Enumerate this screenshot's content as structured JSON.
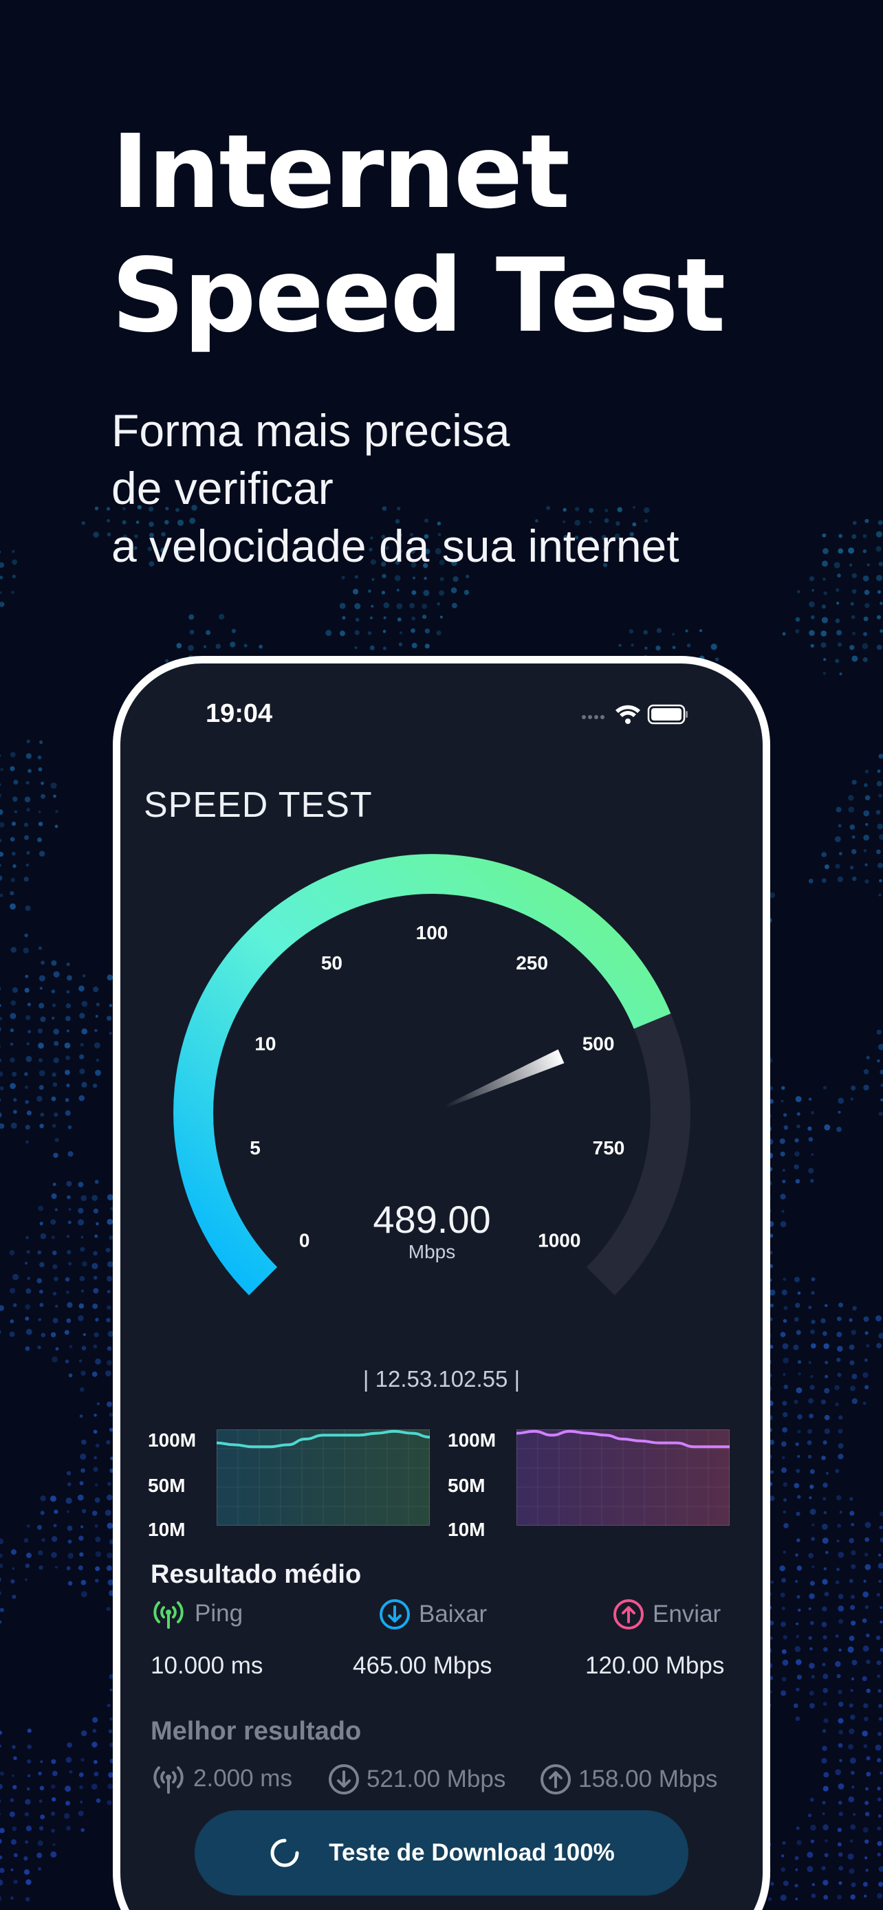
{
  "promo": {
    "title_line1": "Internet",
    "title_line2": "Speed Test",
    "subtitle_line1": "Forma mais precisa",
    "subtitle_line2": "de verificar",
    "subtitle_line3": "a velocidade da sua internet"
  },
  "status_bar": {
    "time": "19:04",
    "icons": [
      "signal-dots-icon",
      "wifi-icon",
      "battery-icon"
    ]
  },
  "app": {
    "title": "SPEED TEST"
  },
  "gauge": {
    "ticks": [
      "0",
      "5",
      "10",
      "50",
      "100",
      "250",
      "500",
      "750",
      "1000"
    ],
    "value": "489.00",
    "unit": "Mbps",
    "fill_fraction": 0.75,
    "colors": {
      "start": "#00b4ff",
      "mid": "#5ef2d8",
      "end": "#6ef58a",
      "track": "#262a38"
    }
  },
  "ip": "| 12.53.102.55 |",
  "download_chart": {
    "labels": [
      "100M",
      "50M",
      "10M"
    ],
    "line_color": "#4fd8d0",
    "values": [
      0.86,
      0.84,
      0.82,
      0.82,
      0.84,
      0.9,
      0.94,
      0.94,
      0.94,
      0.96,
      0.98,
      0.96,
      0.92
    ]
  },
  "upload_chart": {
    "labels": [
      "100M",
      "50M",
      "10M"
    ],
    "line_color": "#d080ff",
    "values": [
      0.96,
      0.98,
      0.94,
      0.98,
      0.96,
      0.94,
      0.9,
      0.88,
      0.86,
      0.86,
      0.82,
      0.82,
      0.82
    ]
  },
  "average": {
    "title": "Resultado médio",
    "ping_label": "Ping",
    "ping_value": "10.000 ms",
    "download_label": "Baixar",
    "download_value": "465.00 Mbps",
    "upload_label": "Enviar",
    "upload_value": "120.00 Mbps",
    "colors": {
      "ping": "#59d96b",
      "download": "#1aa8f0",
      "upload": "#f0568e"
    }
  },
  "best": {
    "title": "Melhor resultado",
    "ping_value": "2.000 ms",
    "download_value": "521.00 Mbps",
    "upload_value": "158.00 Mbps"
  },
  "cta": {
    "label": "Teste de Download 100%"
  }
}
